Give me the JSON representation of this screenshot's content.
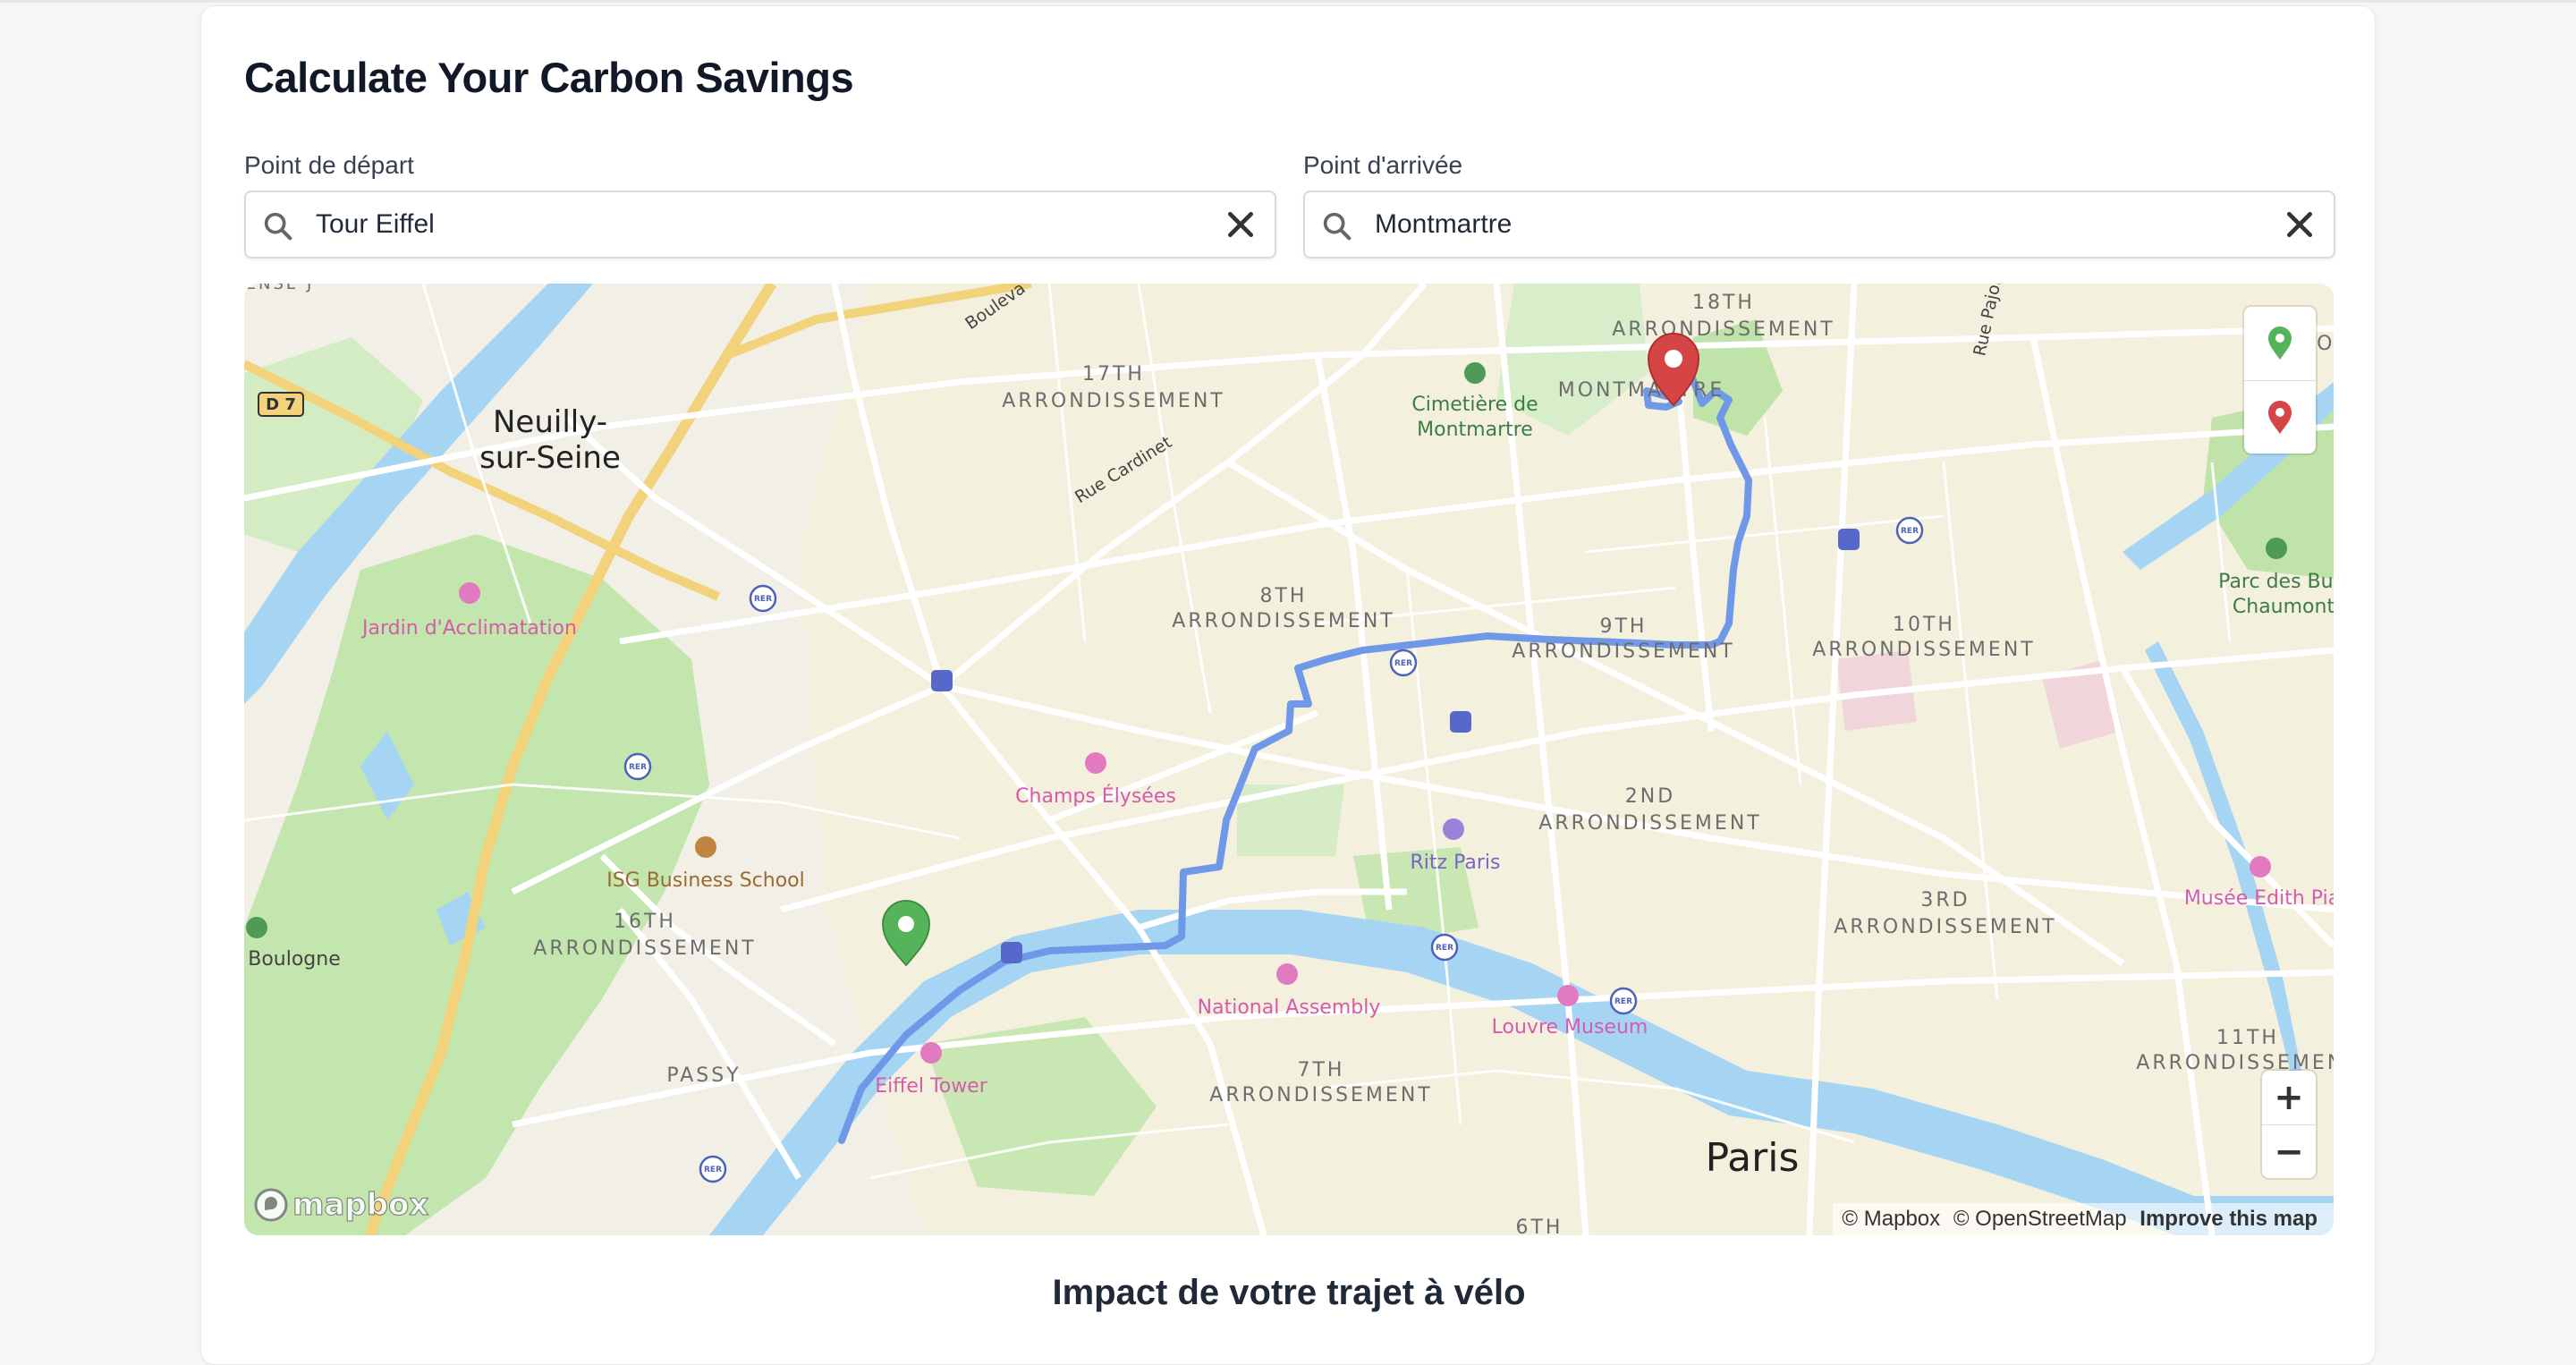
{
  "page": {
    "title": "Calculate Your Carbon Savings",
    "section_heading": "Impact de votre trajet à vélo"
  },
  "start": {
    "label": "Point de départ",
    "value": "Tour Eiffel",
    "icon": "search-icon"
  },
  "end": {
    "label": "Point d'arrivée",
    "value": "Montmartre",
    "icon": "search-icon"
  },
  "map": {
    "place_labels": {
      "neuilly_1": "Neuilly-",
      "neuilly_2": "sur-Seine",
      "paris": "Paris",
      "boulogne": "Boulogne",
      "passy": "PASSY",
      "montmartre": "MONTMARTRE",
      "arr17_a": "17TH",
      "arr17_b": "ARRONDISSEMENT",
      "arr18_a": "18TH",
      "arr18_b": "ARRONDISSEMENT",
      "arr8_a": "8TH",
      "arr8_b": "ARRONDISSEMENT",
      "arr9_a": "9TH",
      "arr9_b": "ARRONDISSEMENT",
      "arr10_a": "10TH",
      "arr10_b": "ARRONDISSEMENT",
      "arr2_a": "2ND",
      "arr2_b": "ARRONDISSEMENT",
      "arr3_a": "3RD",
      "arr3_b": "ARRONDISSEMENT",
      "arr16_a": "16TH",
      "arr16_b": "ARRONDISSEMENT",
      "arr7_a": "7TH",
      "arr7_b": "ARRONDISSEMENT",
      "arr11_a": "11TH",
      "arr11_b": "ARRONDISSEMENT",
      "arr6": "6TH",
      "arr19": "ARRO",
      "ense": "ENSE J"
    },
    "poi_labels": {
      "jardin": "Jardin d'Acclimatation",
      "cimetiere_1": "Cimetière de",
      "cimetiere_2": "Montmartre",
      "champs": "Champs Élysées",
      "ritz": "Ritz Paris",
      "isg": "ISG Business School",
      "national_assembly": "National Assembly",
      "louvre": "Louvre Museum",
      "eiffel": "Eiffel Tower",
      "parc_1": "Parc des Butt",
      "parc_2": "Chaumont",
      "musee": "Musée Edith Pia"
    },
    "street_labels": {
      "boulevard": "Bouleva",
      "rue_cardinet": "Rue Cardinet",
      "rue_pajol": "Rue Pajol",
      "d7": "D 7"
    },
    "controls": {
      "zoom_in": "+",
      "zoom_out": "−",
      "start_marker_icon": "green-pin-icon",
      "end_marker_icon": "red-pin-icon"
    },
    "attribution": {
      "mapbox": "© Mapbox",
      "osm": "© OpenStreetMap",
      "improve": "Improve this map",
      "logo": "mapbox"
    },
    "colors": {
      "route": "#6f98e8",
      "start_pin": "#55b45a",
      "end_pin": "#d64545",
      "water": "#9fd0f2",
      "park": "#b9e3a5"
    }
  }
}
